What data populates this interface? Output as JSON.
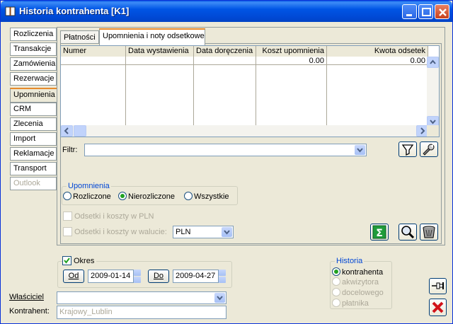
{
  "window": {
    "title": "Historia kontrahenta [K1]"
  },
  "side_tabs": [
    {
      "label": "Rozliczenia",
      "active": false,
      "disabled": false
    },
    {
      "label": "Transakcje",
      "active": false,
      "disabled": false
    },
    {
      "label": "Zamówienia",
      "active": false,
      "disabled": false
    },
    {
      "label": "Rezerwacje",
      "active": false,
      "disabled": false
    },
    {
      "label": "Upomnienia",
      "active": true,
      "disabled": false
    },
    {
      "label": "CRM",
      "active": false,
      "disabled": false
    },
    {
      "label": "Zlecenia",
      "active": false,
      "disabled": false
    },
    {
      "label": "Import",
      "active": false,
      "disabled": false
    },
    {
      "label": "Reklamacje",
      "active": false,
      "disabled": false
    },
    {
      "label": "Transport",
      "active": false,
      "disabled": false
    },
    {
      "label": "Outlook",
      "active": false,
      "disabled": true
    }
  ],
  "inner_tabs": [
    {
      "label": "Płatności",
      "active": false
    },
    {
      "label": "Upomnienia i noty odsetkowe",
      "active": true
    }
  ],
  "grid": {
    "columns": [
      {
        "label": "Numer",
        "align": "left",
        "sum": ""
      },
      {
        "label": "Data wystawienia",
        "align": "left",
        "sum": ""
      },
      {
        "label": "Data doręczenia",
        "align": "left",
        "sum": ""
      },
      {
        "label": "Koszt upomnienia",
        "align": "right",
        "sum": "0.00"
      },
      {
        "label": "Kwota odsetek",
        "align": "right",
        "sum": "0.00"
      }
    ]
  },
  "filter": {
    "label": "Filtr:",
    "value": ""
  },
  "upomnienia": {
    "title": "Upomnienia",
    "options": [
      {
        "label": "Rozliczone",
        "selected": false
      },
      {
        "label": "Nierozliczone",
        "selected": true
      },
      {
        "label": "Wszystkie",
        "selected": false
      }
    ]
  },
  "options": {
    "pln_label": "Odsetki i koszty w PLN",
    "waluta_label": "Odsetki i koszty w walucie:",
    "currency": "PLN"
  },
  "okres": {
    "label": "Okres",
    "checked": true,
    "from_label": "Od",
    "from_value": "2009-01-14",
    "to_label": "Do",
    "to_value": "2009-04-27"
  },
  "historia": {
    "title": "Historia",
    "options": [
      {
        "label": "kontrahenta",
        "selected": true,
        "disabled": false
      },
      {
        "label": "akwizytora",
        "selected": false,
        "disabled": true
      },
      {
        "label": "docelowego",
        "selected": false,
        "disabled": true
      },
      {
        "label": "płatnika",
        "selected": false,
        "disabled": true
      }
    ]
  },
  "wlasciciel": {
    "label": "Właściciel",
    "value": ""
  },
  "kontrahent": {
    "label": "Kontrahent:",
    "value": "Krajowy_Lublin"
  },
  "colors": {
    "titlebar": "#0055e5",
    "accent_green": "#21a121",
    "close_red": "#c8401c"
  }
}
